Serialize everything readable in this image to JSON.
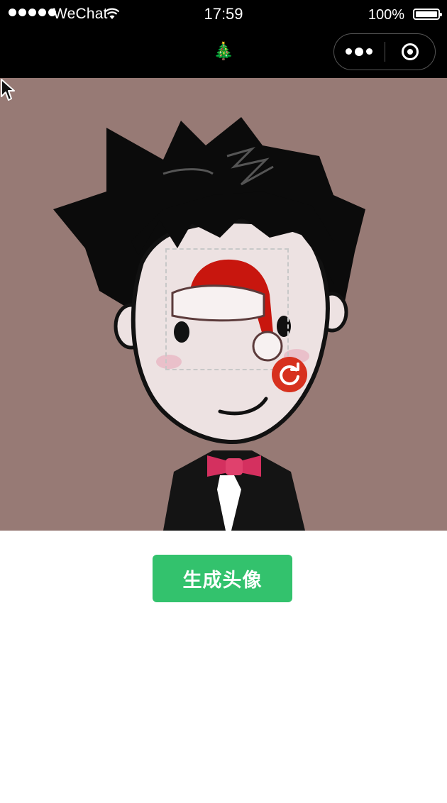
{
  "status_bar": {
    "carrier": "WeChat",
    "time": "17:59",
    "battery": "100%"
  },
  "nav": {
    "title": "🎄",
    "capsule_more_icon": "more-dots-icon",
    "capsule_close_icon": "target-close-icon"
  },
  "editor": {
    "background_color": "#977a75",
    "sticker": "santa-hat",
    "rotate_icon": "rotate-icon"
  },
  "actions": {
    "generate_label": "生成头像",
    "button_color": "#33c26d"
  }
}
